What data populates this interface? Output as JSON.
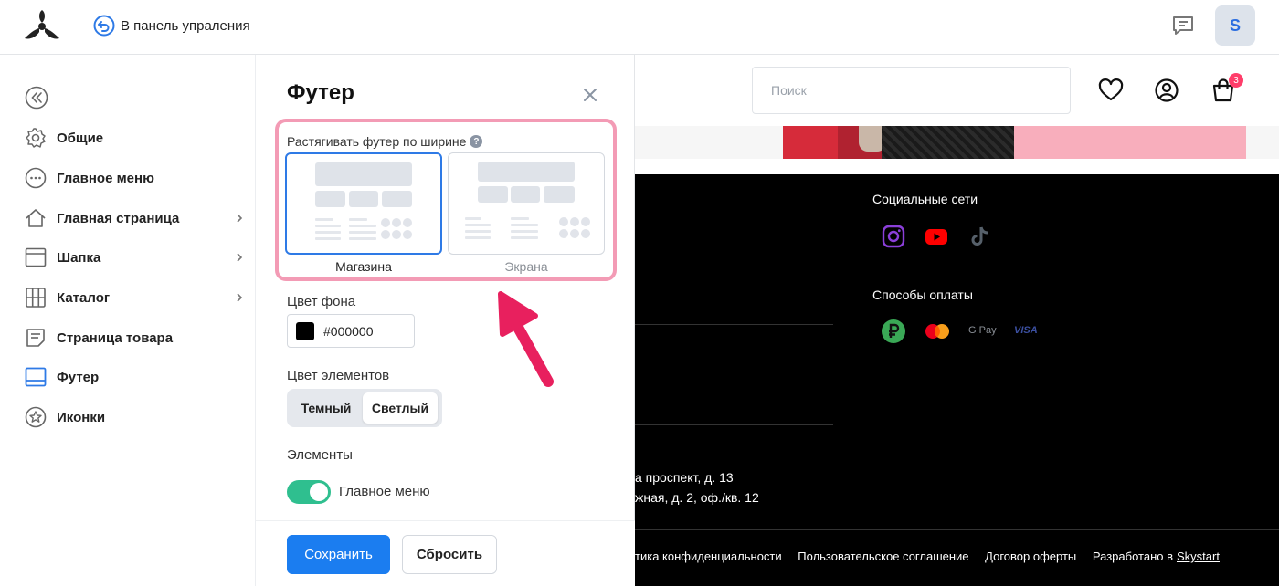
{
  "topbar": {
    "back_label": "В панель упраления",
    "avatar_letter": "S"
  },
  "sidebar": {
    "items": [
      {
        "label": "Общие",
        "icon": "gear-icon"
      },
      {
        "label": "Главное меню",
        "icon": "more-circle-icon"
      },
      {
        "label": "Главная страница",
        "icon": "home-icon"
      },
      {
        "label": "Шапка",
        "icon": "header-layout-icon"
      },
      {
        "label": "Каталог",
        "icon": "grid-icon"
      },
      {
        "label": "Страница товара",
        "icon": "document-icon"
      },
      {
        "label": "Футер",
        "icon": "footer-layout-icon",
        "active": true
      },
      {
        "label": "Иконки",
        "icon": "star-circle-icon"
      }
    ]
  },
  "panel": {
    "title": "Футер",
    "stretch_label": "Растягивать футер по ширине",
    "help": "?",
    "options": [
      {
        "label": "Магазина",
        "selected": true
      },
      {
        "label": "Экрана",
        "selected": false
      }
    ],
    "bg_label": "Цвет фона",
    "bg_value": "#000000",
    "elements_color_label": "Цвет элементов",
    "elements_color_options": [
      "Темный",
      "Светлый"
    ],
    "elements_color_selected": "Светлый",
    "elements_label": "Элементы",
    "main_menu_toggle_label": "Главное меню",
    "main_menu_toggle_on": true,
    "save_label": "Сохранить",
    "reset_label": "Сбросить"
  },
  "preview": {
    "search_placeholder": "Поиск",
    "cart_count": "3",
    "social_heading": "Социальные сети",
    "payments_heading": "Способы оплаты",
    "pay_gpay": "G Pay",
    "pay_visa": "VISA",
    "address_line1": "а проспект, д. 13",
    "address_line2": "жная, д. 2, оф./кв. 12",
    "links": [
      "тика конфиденциальности",
      "Пользовательское соглашение",
      "Договор оферты"
    ],
    "developed_prefix": "Разработано в",
    "developed_brand": "Skystart"
  },
  "colors": {
    "accent": "#1b7df0",
    "toggle_on": "#2fbf8f",
    "highlight": "#f39bb5",
    "arrow": "#e8205e",
    "footer_bg": "#000000"
  }
}
